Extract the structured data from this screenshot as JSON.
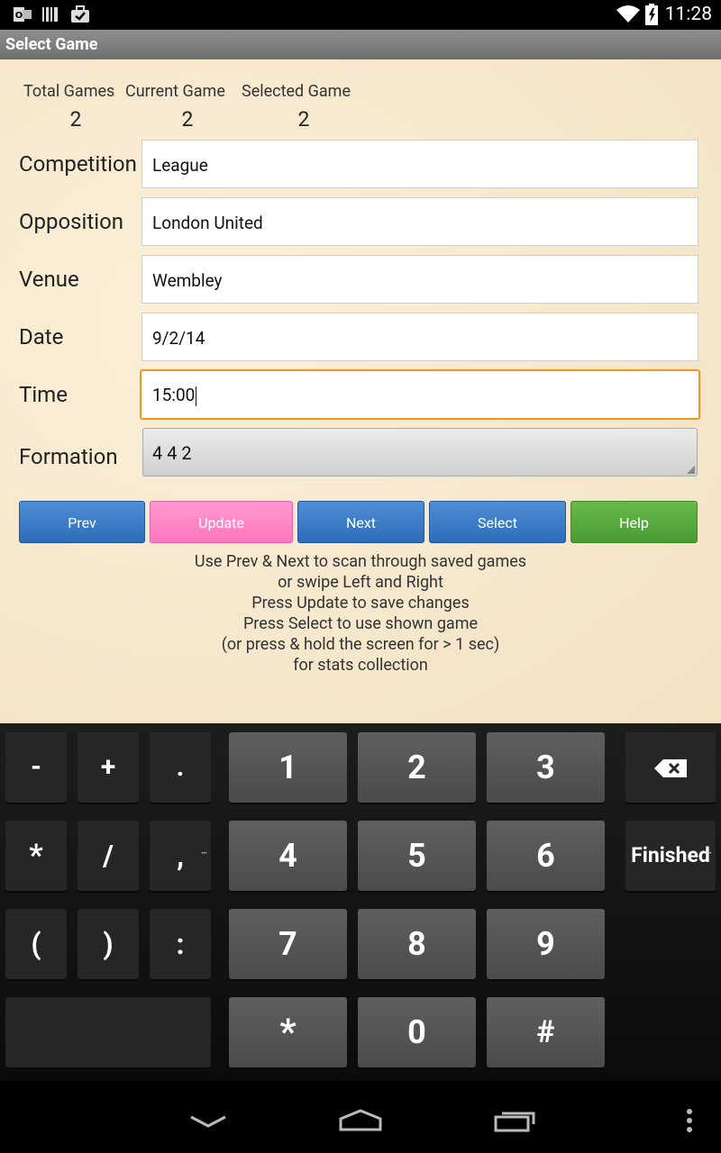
{
  "status_bar": {
    "time": "11:28"
  },
  "app_bar": {
    "title": "Select Game"
  },
  "counts": {
    "total_label": "Total Games",
    "current_label": "Current Game",
    "selected_label": "Selected Game",
    "total_value": "2",
    "current_value": "2",
    "selected_value": "2"
  },
  "form": {
    "competition_label": "Competition",
    "competition_value": "League",
    "opposition_label": "Opposition",
    "opposition_value": "London United",
    "venue_label": "Venue",
    "venue_value": "Wembley",
    "date_label": "Date",
    "date_value": "9/2/14",
    "time_label": "Time",
    "time_value": "15:00",
    "formation_label": "Formation",
    "formation_value": "4 4 2"
  },
  "buttons": {
    "prev": "Prev",
    "update": "Update",
    "next": "Next",
    "select": "Select",
    "help": "Help"
  },
  "instructions": [
    "Use Prev & Next to scan through saved games",
    "or swipe Left and Right",
    "Press Update to save changes",
    "Press Select to use shown game",
    "(or press & hold the screen for > 1 sec)",
    "for stats collection"
  ],
  "keyboard": {
    "row1": [
      "-",
      "+",
      ".",
      "1",
      "2",
      "3"
    ],
    "row2": [
      "*",
      "/",
      ",",
      "4",
      "5",
      "6"
    ],
    "row3": [
      "(",
      ")",
      ":",
      "7",
      "8",
      "9"
    ],
    "row4": [
      "*",
      "0",
      "#"
    ],
    "finished": "Finished"
  },
  "colors": {
    "focus_border": "#f5951f",
    "button_blue": "#3a7cc6",
    "button_pink": "#ff85c6",
    "button_green": "#57a83e"
  }
}
